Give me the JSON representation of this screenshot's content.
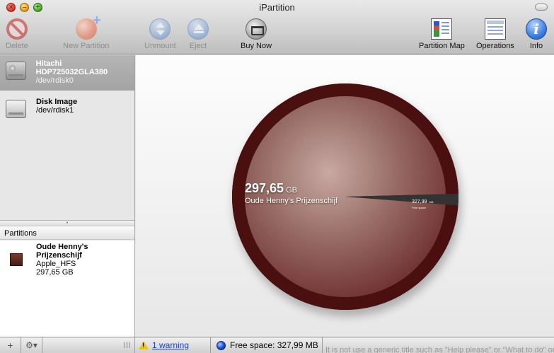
{
  "window": {
    "title": "iPartition"
  },
  "toolbar": {
    "delete": "Delete",
    "new_partition": "New Partition",
    "unmount": "Unmount",
    "eject": "Eject",
    "buy_now": "Buy Now",
    "partition_map": "Partition Map",
    "operations": "Operations",
    "info": "Info"
  },
  "disks": [
    {
      "name": "Hitachi HDP725032GLA380",
      "device": "/dev/rdisk0",
      "icon": "hard-drive-icon",
      "selected": true
    },
    {
      "name": "Disk Image",
      "device": "/dev/rdisk1",
      "icon": "disk-image-icon",
      "selected": false
    }
  ],
  "partitions_panel": {
    "header": "Partitions",
    "items": [
      {
        "name": "Oude Henny's Prijzenschijf",
        "format": "Apple_HFS",
        "size": "297,65 GB"
      }
    ]
  },
  "chart_data": {
    "type": "pie",
    "slices": [
      {
        "label": "Oude Henny's Prijzenschijf",
        "value": 297.65,
        "unit": "GB",
        "display_size": "297,65",
        "display_unit": "GB",
        "color": "#5a1a1a"
      },
      {
        "label": "Free space",
        "value": 0.32,
        "unit": "GB",
        "display_size": "327,99",
        "display_unit": "MB",
        "color": "#333333"
      }
    ]
  },
  "statusbar": {
    "add_symbol": "+",
    "gear_symbol": "⚙▾",
    "resize_symbol": "|||",
    "warning_text": "1 warning",
    "free_space_text": "Free space: 327,99 MB",
    "background_text": "It is not use a generic title such as \"Help please\" or \"What to do\" or \"Need advice"
  },
  "colors": {
    "partition": "#5a1a1a",
    "free": "#333333",
    "selection": "#a9a9a9",
    "link": "#1a3fd1"
  }
}
